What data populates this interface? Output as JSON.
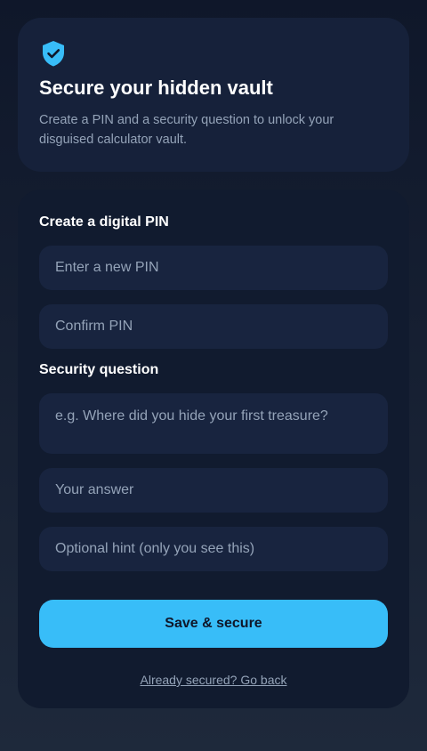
{
  "header": {
    "icon": "shield-check-icon",
    "title": "Secure your hidden vault",
    "subtitle": "Create a PIN and a security question to unlock your disguised calculator vault."
  },
  "form": {
    "pin_section_label": "Create a digital PIN",
    "new_pin_placeholder": "Enter a new PIN",
    "confirm_pin_placeholder": "Confirm PIN",
    "question_section_label": "Security question",
    "question_placeholder": "e.g. Where did you hide your first treasure?",
    "answer_placeholder": "Your answer",
    "hint_placeholder": "Optional hint (only you see this)",
    "save_label": "Save & secure",
    "back_link": "Already secured? Go back"
  },
  "colors": {
    "accent": "#38bdf8",
    "background": "#0f172a",
    "card": "#16213a",
    "field": "#18243f"
  }
}
